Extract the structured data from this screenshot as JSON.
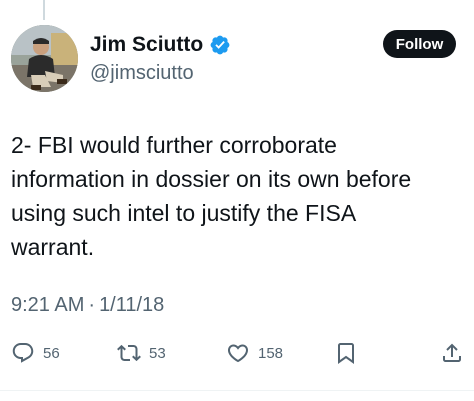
{
  "author": {
    "display_name": "Jim Sciutto",
    "handle": "@jimsciutto",
    "verified": true,
    "avatar_icon": "profile-photo"
  },
  "follow_button": {
    "label": "Follow"
  },
  "tweet": {
    "lines": [
      "2- FBI would further corroborate",
      "information in dossier on its own before",
      "using such intel to justify the FISA",
      "warrant."
    ]
  },
  "meta": {
    "time": "9:21 AM",
    "separator": "·",
    "date": "1/11/18"
  },
  "actions": {
    "replies": "56",
    "retweets": "53",
    "likes": "158"
  },
  "colors": {
    "text": "#0f1419",
    "secondary": "#536471",
    "verified": "#1d9bf0",
    "button_bg": "#0f1419"
  },
  "icons": {
    "reply": "reply-icon",
    "retweet": "retweet-icon",
    "like": "like-icon",
    "bookmark": "bookmark-icon",
    "share": "share-icon",
    "verified": "verified-badge-icon"
  }
}
